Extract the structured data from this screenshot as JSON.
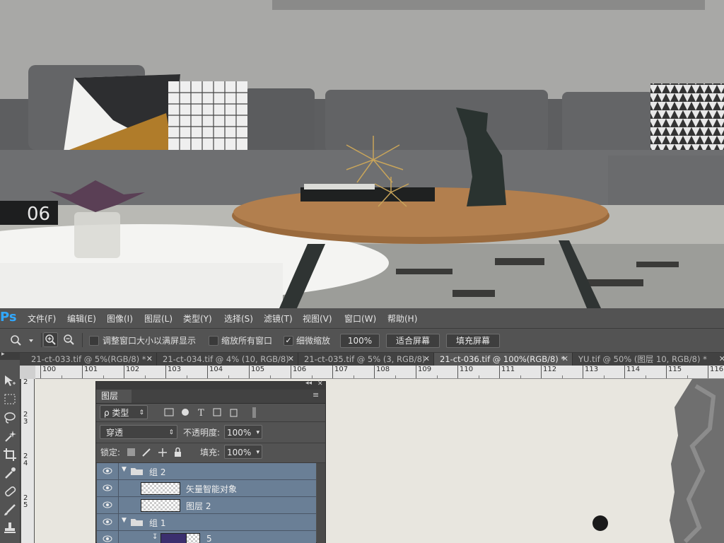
{
  "menubar": {
    "logo": "Ps",
    "items": [
      "文件(F)",
      "编辑(E)",
      "图像(I)",
      "图层(L)",
      "类型(Y)",
      "选择(S)",
      "滤镜(T)",
      "视图(V)",
      "窗口(W)",
      "帮助(H)"
    ]
  },
  "options": {
    "resize_windows": "调整窗口大小以满屏显示",
    "zoom_all": "缩放所有窗口",
    "scrubby_zoom": "细微缩放",
    "zoom_value": "100%",
    "fit_screen": "适合屏幕",
    "fill_screen": "填充屏幕"
  },
  "tabs": [
    {
      "label": "21-ct-033.tif @ 5%(RGB/8) *"
    },
    {
      "label": "21-ct-034.tif @ 4% (10, RGB/8)"
    },
    {
      "label": "21-ct-035.tif @ 5% (3, RGB/8)"
    },
    {
      "label": "21-ct-036.tif @ 100%(RGB/8) *"
    },
    {
      "label": "YU.tif @ 50% (图层 10, RGB/8) *"
    }
  ],
  "ruler": [
    "100",
    "101",
    "102",
    "103",
    "104",
    "105",
    "106",
    "107",
    "108",
    "109",
    "110",
    "111",
    "112",
    "113",
    "114",
    "115",
    "116"
  ],
  "vruler": [
    "2",
    "2 3",
    "2 4",
    "2 5"
  ],
  "photo": {
    "clock_digits": "06"
  },
  "layers_panel": {
    "title": "图层",
    "kind_filter": "ρ 类型",
    "blend_mode": "穿透",
    "opacity_label": "不透明度:",
    "opacity_value": "100%",
    "lock_label": "锁定:",
    "fill_label": "填充:",
    "fill_value": "100%",
    "layers": [
      {
        "name": "组 2"
      },
      {
        "name": "矢量智能对象"
      },
      {
        "name": "图层 2"
      },
      {
        "name": "组 1"
      },
      {
        "name": "5"
      }
    ]
  },
  "colors": {
    "ps_blue": "#31a8ff",
    "layer_selected": "#6a7f96",
    "canvas": "#e8e6df"
  }
}
